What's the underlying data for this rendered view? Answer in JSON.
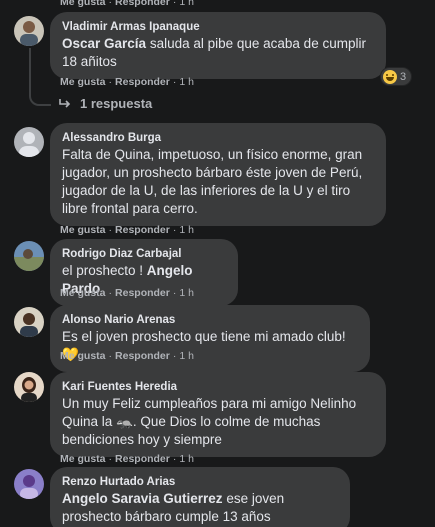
{
  "comments": [
    {
      "author": "Vladimir Armas Ipanaque",
      "mention": "Oscar García",
      "text": " saluda al pibe que acaba de cumplir 18 añitos",
      "actions": {
        "like": "Me gusta",
        "reply": "Responder",
        "time": "1 h"
      },
      "reaction_count": "3"
    },
    {
      "author": "Alessandro Burga",
      "mention": "",
      "text": "Falta de Quina, impetuoso, un físico enorme, gran jugador, un proshecto bárbaro éste joven de Perú, jugador de la U, de las inferiores de la U y el tiro libre frontal para cerro.",
      "actions": {
        "like": "Me gusta",
        "reply": "Responder",
        "time": "1 h"
      }
    },
    {
      "author": "Rodrigo Diaz Carbajal",
      "prefix": "el proshecto ! ",
      "mention": "Angelo Pardo",
      "text": "",
      "actions": {
        "like": "Me gusta",
        "reply": "Responder",
        "time": "1 h"
      }
    },
    {
      "author": "Alonso Nario Arenas",
      "mention": "",
      "text": "Es el joven proshecto que tiene mi amado club! 💛",
      "actions": {
        "like": "Me gusta",
        "reply": "Responder",
        "time": "1 h"
      }
    },
    {
      "author": "Kari Fuentes Heredia",
      "mention": "",
      "text": "Un muy Feliz cumpleaños para mi amigo Nelinho Quina la 🦡. Que Dios lo colme de muchas bendiciones hoy y siempre",
      "actions": {
        "like": "Me gusta",
        "reply": "Responder",
        "time": "1 h"
      }
    },
    {
      "author": "Renzo Hurtado Arias",
      "mention": "Angelo Saravia Gutierrez",
      "text": " ese joven proshecto bárbaro cumple 13 años",
      "actions": {}
    }
  ],
  "top_actions": {
    "like": "Me gusta",
    "reply": "Responder",
    "time": "1 h"
  },
  "replies_label": "1 respuesta",
  "colors": {
    "background": "#18191a",
    "bubble": "#3a3b3c",
    "text": "#e4e6eb",
    "secondary": "#b0b3b8"
  },
  "icons": [
    "haha-reaction-icon",
    "reply-arrow-icon",
    "heart-yellow-emoji",
    "avatar"
  ]
}
